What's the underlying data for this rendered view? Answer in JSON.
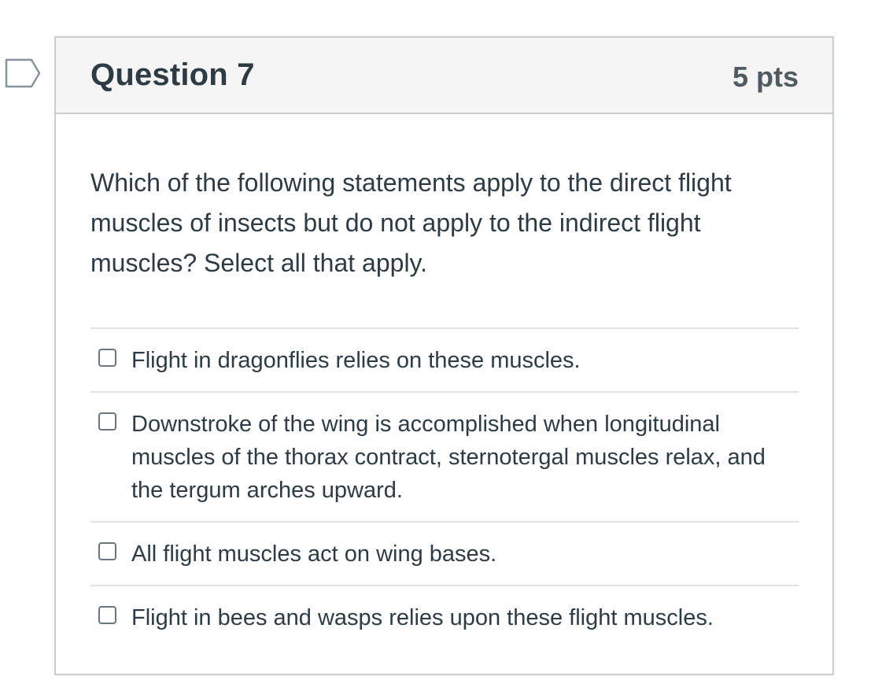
{
  "question": {
    "title": "Question 7",
    "points": "5 pts",
    "text": "Which of the following statements apply to the direct flight muscles of insects but do not apply to the indirect flight muscles? Select all that apply."
  },
  "answers": [
    {
      "label": "Flight in dragonflies relies on these muscles.",
      "checked": false
    },
    {
      "label": "Downstroke of the wing is accomplished when longitudinal muscles of the thorax contract, sternotergal muscles relax, and the tergum arches upward.",
      "checked": false
    },
    {
      "label": "All flight muscles act on wing bases.",
      "checked": false
    },
    {
      "label": "Flight in bees and wasps relies upon these flight muscles.",
      "checked": false
    }
  ],
  "icons": {
    "flag": "bookmark-flag-icon"
  },
  "colors": {
    "text": "#2d3b45",
    "header_bg": "#f5f5f5",
    "border": "#c7cdd1",
    "flag_stroke": "#8893a0"
  }
}
